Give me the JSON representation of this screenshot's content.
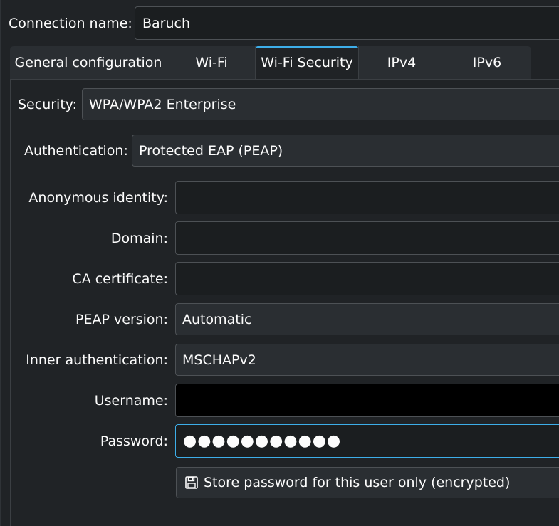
{
  "connection": {
    "name_label": "Connection name:",
    "name_value": "Baruch"
  },
  "tabs": [
    {
      "label": "General configuration",
      "active": false
    },
    {
      "label": "Wi-Fi",
      "active": false
    },
    {
      "label": "Wi-Fi Security",
      "active": true
    },
    {
      "label": "IPv4",
      "active": false
    },
    {
      "label": "IPv6",
      "active": false
    }
  ],
  "security": {
    "security_label": "Security:",
    "security_value": "WPA/WPA2 Enterprise",
    "auth_label": "Authentication:",
    "auth_value": "Protected EAP (PEAP)",
    "anon_label": "Anonymous identity:",
    "anon_value": "",
    "domain_label": "Domain:",
    "domain_value": "",
    "ca_label": "CA certificate:",
    "ca_value": "",
    "peap_label": "PEAP version:",
    "peap_value": "Automatic",
    "inner_label": "Inner authentication:",
    "inner_value": "MSCHAPv2",
    "username_label": "Username:",
    "username_value": "",
    "password_label": "Password:",
    "password_value": "●●●●●●●●●●●",
    "store_password_label": "Store password for this user only (encrypted)"
  },
  "colors": {
    "accent": "#3daee9",
    "background": "#202326",
    "field": "#1b1e20"
  },
  "icons": {
    "store_password": "save-icon"
  }
}
